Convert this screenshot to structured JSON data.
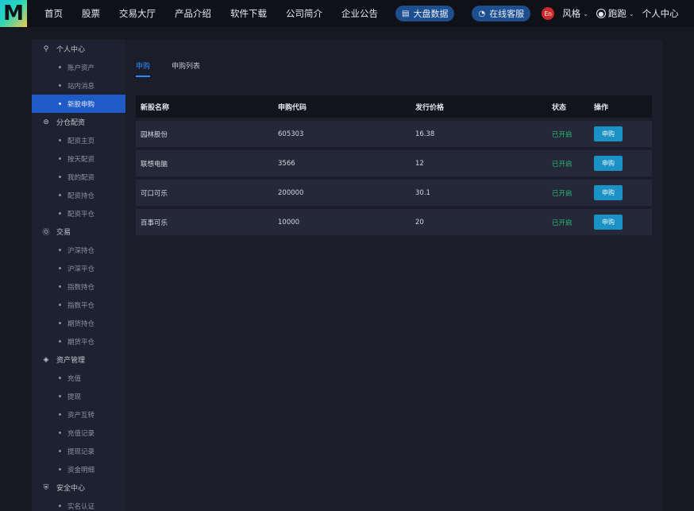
{
  "brand": {
    "logo_letter": "M"
  },
  "nav": {
    "items": [
      "首页",
      "股票",
      "交易大厅",
      "产品介绍",
      "软件下载",
      "公司简介",
      "企业公告"
    ],
    "market_pill": "大盘数据",
    "service_pill": "在线客服",
    "lang": "En",
    "style": "风格",
    "user": "跑跑",
    "personal_center": "个人中心"
  },
  "sidebar": {
    "sections": [
      {
        "title": "个人中心",
        "icon": "user-icon",
        "items": [
          "账户资产",
          "站内消息",
          "新股申购"
        ]
      },
      {
        "title": "分仓配资",
        "icon": "split-icon",
        "items": [
          "配资主页",
          "按天配资",
          "我的配资",
          "配资持仓",
          "配资平仓"
        ]
      },
      {
        "title": "交易",
        "icon": "dollar-icon",
        "items": [
          "沪深持仓",
          "沪深平仓",
          "指数持仓",
          "指数平仓",
          "期货持仓",
          "期货平仓"
        ]
      },
      {
        "title": "资产管理",
        "icon": "layers-icon",
        "items": [
          "充值",
          "提现",
          "资产互转",
          "充值记录",
          "提现记录",
          "资金明细"
        ]
      },
      {
        "title": "安全中心",
        "icon": "shield-icon",
        "items": [
          "实名认证"
        ]
      }
    ],
    "active_item": "新股申购"
  },
  "tabs": [
    "申购",
    "申购列表"
  ],
  "table": {
    "headers": [
      "新股名称",
      "申购代码",
      "发行价格",
      "状态",
      "操作"
    ],
    "rows": [
      {
        "name": "园林股份",
        "code": "605303",
        "price": "16.38",
        "status": "已开启",
        "action": "申购"
      },
      {
        "name": "联想电脑",
        "code": "3566",
        "price": "12",
        "status": "已开启",
        "action": "申购"
      },
      {
        "name": "可口可乐",
        "code": "200000",
        "price": "30.1",
        "status": "已开启",
        "action": "申购"
      },
      {
        "name": "百事可乐",
        "code": "10000",
        "price": "20",
        "status": "已开启",
        "action": "申购"
      }
    ]
  },
  "colors": {
    "accent": "#1e5bc6",
    "status_green": "#2bb673",
    "button": "#1b91c6",
    "lang_badge": "#cc2a2a"
  }
}
